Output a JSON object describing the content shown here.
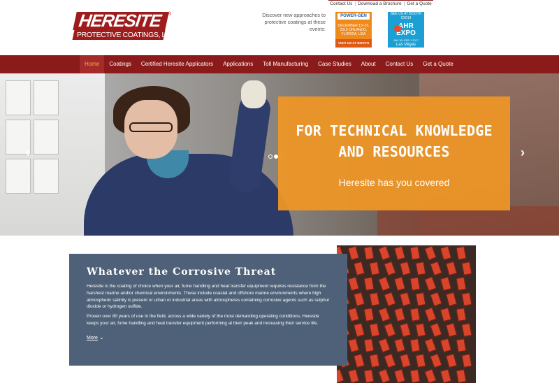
{
  "top_links": {
    "contact": "Contact Us",
    "download": "Download a Brochure",
    "quote": "Get a Quote",
    "sep": "|"
  },
  "logo": {
    "main": "HERESITE",
    "sub": "PROTECTIVE COATINGS, LLC",
    "reg": "®"
  },
  "events": {
    "text": "Discover new approaches to protective coatings at these events:",
    "powergen": {
      "name": "POWER-GEN",
      "date": "DECEMBER 13–15, 2016 ORLANDO, FLORIDA, USA",
      "booth": "VISIT US AT BOOTH #4301"
    },
    "ahr": {
      "top": "SEE US AT BOOTH C5019",
      "logo_line1": "AHR",
      "logo_line2": "EXPO",
      "date": "JAN 30–FEB 1 2017",
      "city": "Las Vegas"
    }
  },
  "nav": {
    "items": [
      "Home",
      "Coatings",
      "Certified Heresite Applicators",
      "Applications",
      "Toll Manufacturing",
      "Case Studies",
      "About",
      "Contact Us",
      "Get a Quote"
    ],
    "active_index": 0
  },
  "hero": {
    "title_line1": "FOR TECHNICAL KNOWLEDGE",
    "title_line2": "AND RESOURCES",
    "subtitle": "Heresite has you covered",
    "prev": "‹",
    "next": "›",
    "slide_count": 3,
    "active_slide": 2
  },
  "threat": {
    "title": "Whatever the Corrosive Threat",
    "p1": "Heresite is the coating of choice when your air, fume handling and heat transfer equipment requires resistance from the harshest marine and/or chemical environments. These include coastal and offshore marine environments where high atmospheric salinity is present or urban or industrial areas with atmospheres containing corrosive agents such as sulphur dioxide or hydrogen sulfide.",
    "p2": "Proven over 80 years of use in the field, across a wide variety of the most demanding operating conditions, Heresite keeps your air, fume handling and heat transfer equipment performing at their peak and increasing their service life.",
    "more": "More",
    "more_icon": "⌄"
  },
  "colors": {
    "nav_bg": "#8b1a1a",
    "accent_orange": "#ee9626",
    "panel_blue": "#4e6178"
  }
}
